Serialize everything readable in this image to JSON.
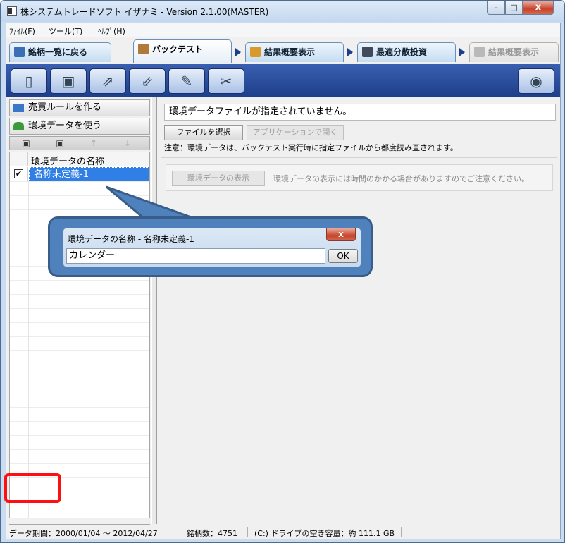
{
  "window": {
    "title": "株システムトレードソフト イザナミ - Version 2.1.00(MASTER)",
    "min_label": "–",
    "max_label": "□",
    "close_label": "x"
  },
  "menu": {
    "items": [
      {
        "label": "ﾌｧｲﾙ(F)"
      },
      {
        "label": "ツール(T)"
      },
      {
        "label": "ﾍﾙﾌﾟ(H)"
      }
    ]
  },
  "tabs": [
    {
      "label": "銘柄一覧に戻る",
      "icon": "stock-list-icon",
      "state": "normal"
    },
    {
      "label": "バックテスト",
      "icon": "backtest-icon",
      "state": "active"
    },
    {
      "label": "結果概要表示",
      "icon": "result-summary-icon",
      "state": "normal"
    },
    {
      "label": "最適分散投資",
      "icon": "optimal-distribution-icon",
      "state": "normal"
    },
    {
      "label": "結果概要表示",
      "icon": "result-summary-icon",
      "state": "disabled"
    }
  ],
  "toolbar": {
    "buttons": [
      {
        "icon": "new-document-icon"
      },
      {
        "icon": "open-icon"
      },
      {
        "icon": "export-icon"
      },
      {
        "icon": "import-icon"
      },
      {
        "icon": "paint-icon"
      },
      {
        "icon": "tools-icon"
      }
    ],
    "right_button_icon": "run-icon"
  },
  "left": {
    "rules_button": "売買ルールを作る",
    "env_button": "環境データを使う",
    "mini_toolbar": [
      {
        "icon": "save-icon",
        "enabled": true
      },
      {
        "icon": "save-as-icon",
        "enabled": true
      },
      {
        "icon": "move-up-icon",
        "enabled": false
      },
      {
        "icon": "move-down-icon",
        "enabled": false
      }
    ],
    "list_header": "環境データの名称",
    "rows": [
      {
        "checked": true,
        "check_mark": "✔",
        "name": "名称未定義-1"
      }
    ],
    "bottom_buttons": [
      {
        "icon": "add-icon",
        "glyph": "+"
      },
      {
        "icon": "copy-icon",
        "glyph": "⎘"
      },
      {
        "icon": "trash-icon",
        "glyph": "🗑"
      }
    ]
  },
  "right": {
    "file_status": "環境データファイルが指定されていません。",
    "select_file_button": "ファイルを選択",
    "open_app_button": "アプリケーションで開く",
    "note": "注意：環境データは、バックテスト実行時に指定ファイルから都度読み直されます。",
    "view_button": "環境データの表示",
    "view_note": "環境データの表示には時間のかかる場合がありますのでご注意ください。"
  },
  "dialog": {
    "title": "環境データの名称 - 名称未定義-1",
    "input_value": "カレンダー",
    "ok_label": "OK",
    "close_label": "x"
  },
  "status": {
    "period": "データ期間：2000/01/04 〜 2012/04/27",
    "count": "銘柄数：4751",
    "disk": "(C:) ドライブの空き容量：約 111.1 GB"
  },
  "colors": {
    "accent_blue": "#2f7fe6",
    "toolbar_bg": "#1e3f8a",
    "callout": "#4f81bd",
    "highlight": "#ff1010"
  }
}
